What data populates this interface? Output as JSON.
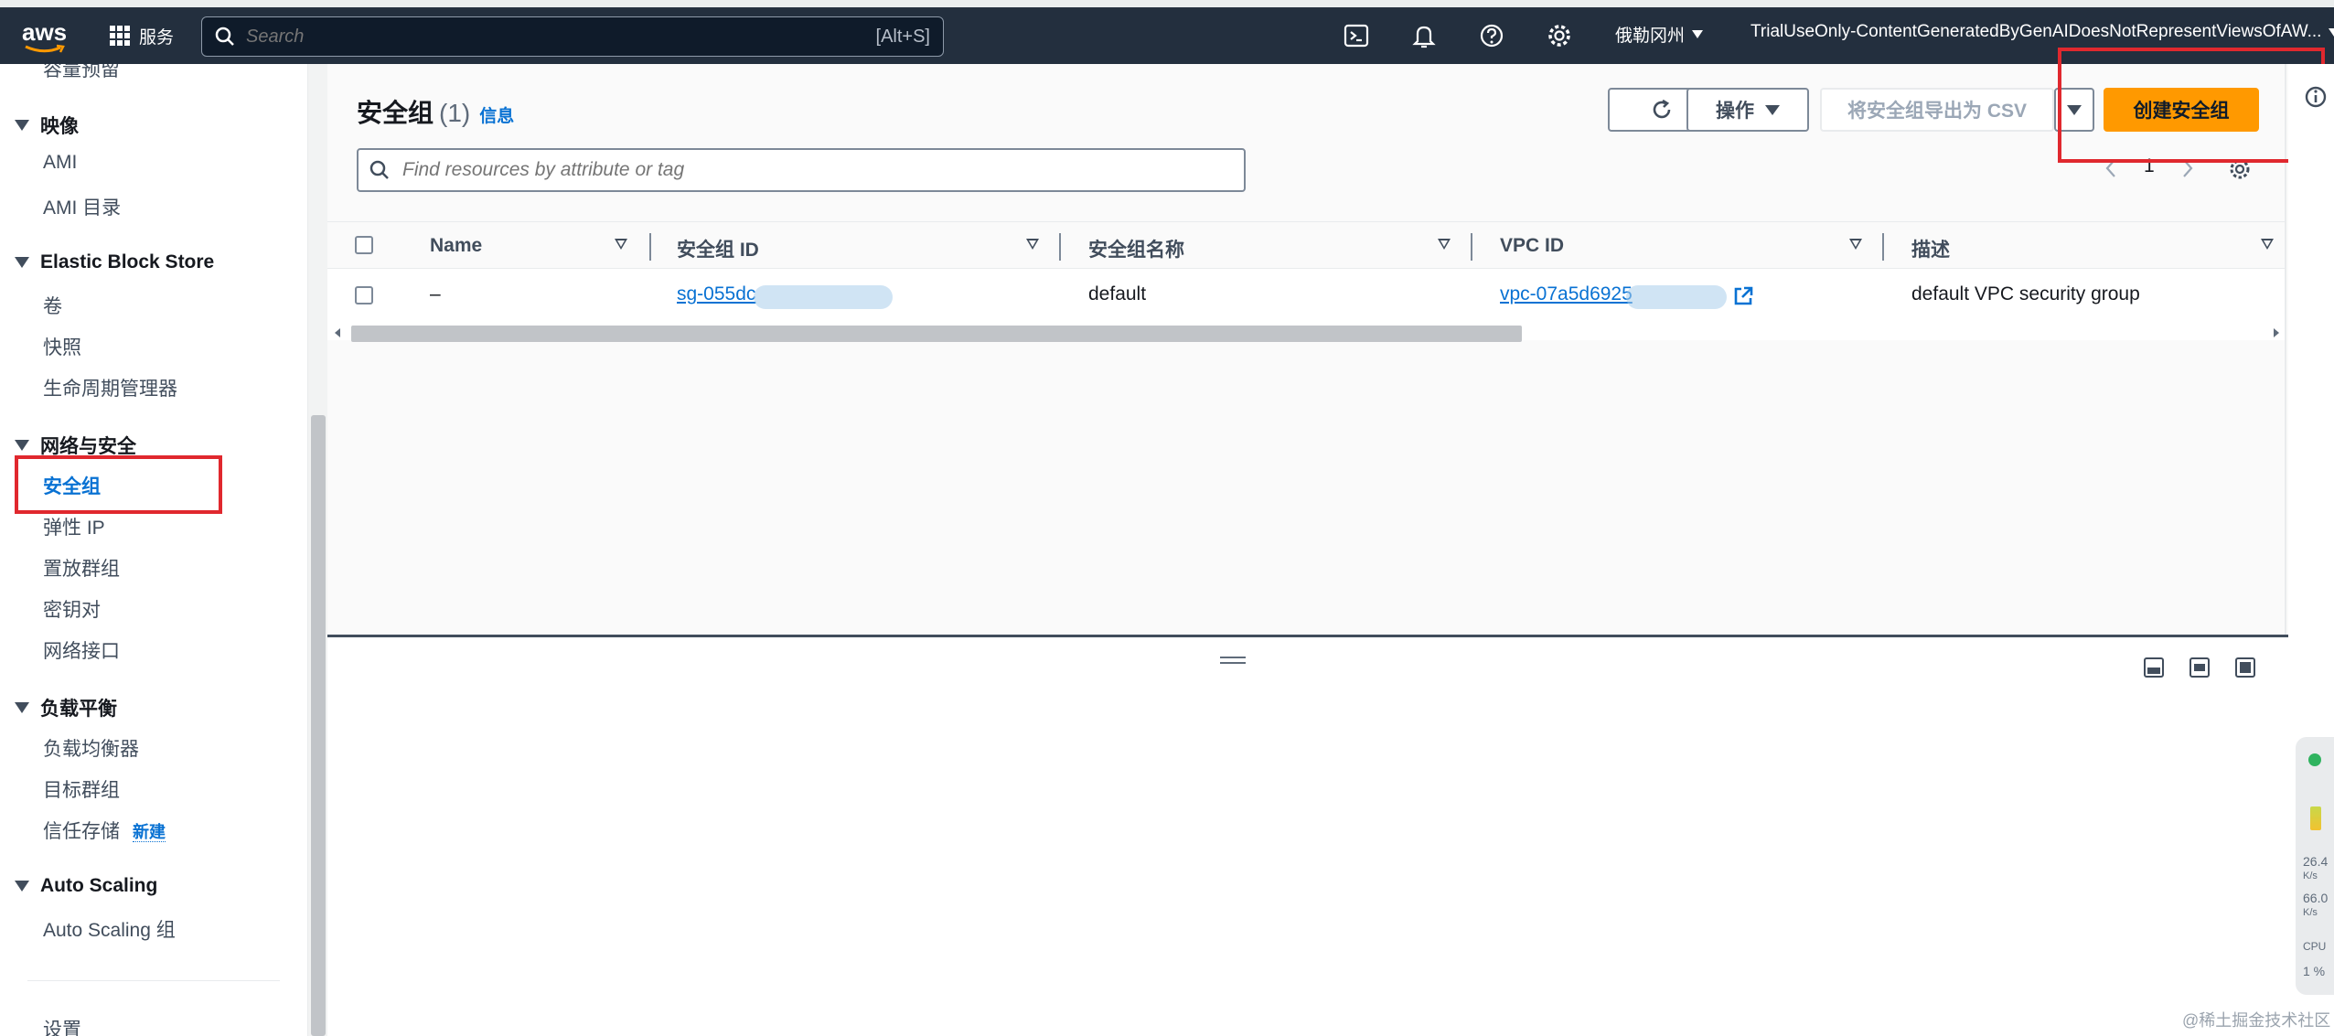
{
  "topnav": {
    "logo_text": "aws",
    "services_label": "服务",
    "search_placeholder": "Search",
    "search_shortcut": "[Alt+S]",
    "region": "俄勒冈州",
    "account": "TrialUseOnly-ContentGeneratedByGenAIDoesNotRepresentViewsOfAW..."
  },
  "sidebar": {
    "cut_top_item": "容量预留",
    "sections": [
      {
        "title": "映像",
        "items": [
          "AMI",
          "AMI 目录"
        ]
      },
      {
        "title": "Elastic Block Store",
        "items": [
          "卷",
          "快照",
          "生命周期管理器"
        ]
      },
      {
        "title": "网络与安全",
        "items": [
          "安全组",
          "弹性 IP",
          "置放群组",
          "密钥对",
          "网络接口"
        ]
      },
      {
        "title": "负载平衡",
        "items": [
          "负载均衡器",
          "目标群组",
          "信任存储"
        ]
      },
      {
        "title": "Auto Scaling",
        "items": [
          "Auto Scaling 组"
        ]
      }
    ],
    "active_item": "安全组",
    "new_badge": "新建",
    "settings_label": "设置"
  },
  "page": {
    "title": "安全组",
    "count": "(1)",
    "info_link": "信息",
    "actions_label": "操作",
    "export_label": "将安全组导出为 CSV",
    "create_label": "创建安全组",
    "filter_placeholder": "Find resources by attribute or tag",
    "page_number": "1"
  },
  "table": {
    "columns": [
      "Name",
      "安全组 ID",
      "安全组名称",
      "VPC ID",
      "描述"
    ],
    "rows": [
      {
        "name": "–",
        "sg_id": "sg-055dc",
        "sg_name": "default",
        "vpc_id": "vpc-07a5d6925",
        "description": "default VPC security group"
      }
    ]
  },
  "monitor": {
    "up": "26.4",
    "up_unit": "K/s",
    "down": "66.0",
    "down_unit": "K/s",
    "cpu_label": "CPU",
    "cpu_value": "1 %"
  },
  "watermark": "@稀土掘金技术社区",
  "colors": {
    "nav_bg": "#232f3e",
    "link": "#0972d3",
    "primary": "#ff9900",
    "highlight": "#e0282e"
  }
}
